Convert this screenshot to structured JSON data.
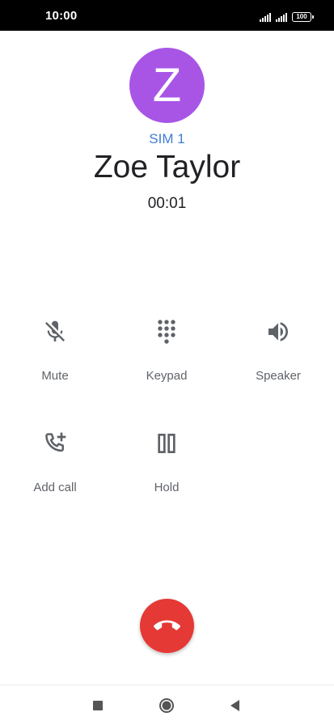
{
  "status_bar": {
    "time": "10:00",
    "battery": "100"
  },
  "contact": {
    "initial": "Z",
    "avatar_color": "#a855e6",
    "sim": "SIM 1",
    "name": "Zoe Taylor",
    "timer": "00:01"
  },
  "controls": {
    "mute": {
      "label": "Mute",
      "icon": "mic-off-icon"
    },
    "keypad": {
      "label": "Keypad",
      "icon": "dialpad-icon"
    },
    "speaker": {
      "label": "Speaker",
      "icon": "volume-icon"
    },
    "add_call": {
      "label": "Add call",
      "icon": "add-call-icon"
    },
    "hold": {
      "label": "Hold",
      "icon": "pause-icon"
    }
  },
  "end_call": {
    "icon": "call-end-icon",
    "color": "#e53935"
  },
  "nav": {
    "recents_icon": "square-icon",
    "home_icon": "circle-icon",
    "back_icon": "triangle-back-icon"
  }
}
